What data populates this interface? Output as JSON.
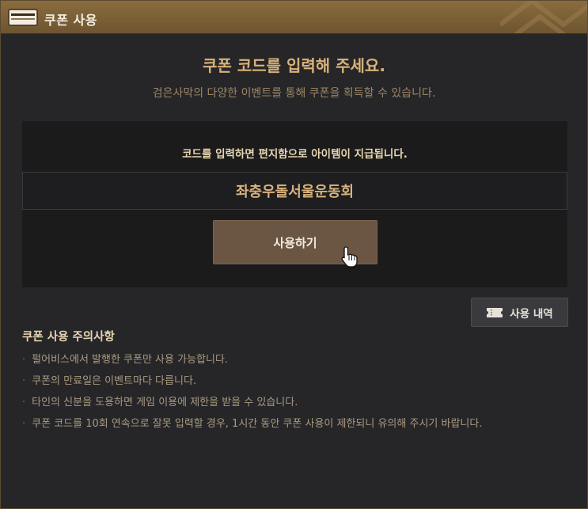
{
  "window": {
    "title": "쿠폰 사용"
  },
  "header": {
    "heading": "쿠폰 코드를 입력해 주세요.",
    "subheading": "검은사막의 다양한 이벤트를 통해 쿠폰을 획득할 수 있습니다."
  },
  "panel": {
    "instruction": "코드를 입력하면 편지함으로 아이템이 지급됩니다.",
    "code_value": "좌충우돌서울운동회",
    "use_button_label": "사용하기"
  },
  "history_button": {
    "label": "사용 내역",
    "icon": "ticket-icon"
  },
  "notices": {
    "title": "쿠폰 사용 주의사항",
    "items": [
      "펄어비스에서 발행한 쿠폰만 사용 가능합니다.",
      "쿠폰의 만료일은 이벤트마다 다릅니다.",
      "타인의 신분을 도용하면 게임 이용에 제한을 받을 수 있습니다.",
      "쿠폰 코드를 10회 연속으로 잘못 입력할 경우, 1시간 동안 쿠폰 사용이 제한되니 유의해 주시기 바랍니다."
    ]
  },
  "colors": {
    "titlebar": "#7a6036",
    "accent_gold": "#d8b27a",
    "button": "#6b5643",
    "background": "#262629"
  }
}
